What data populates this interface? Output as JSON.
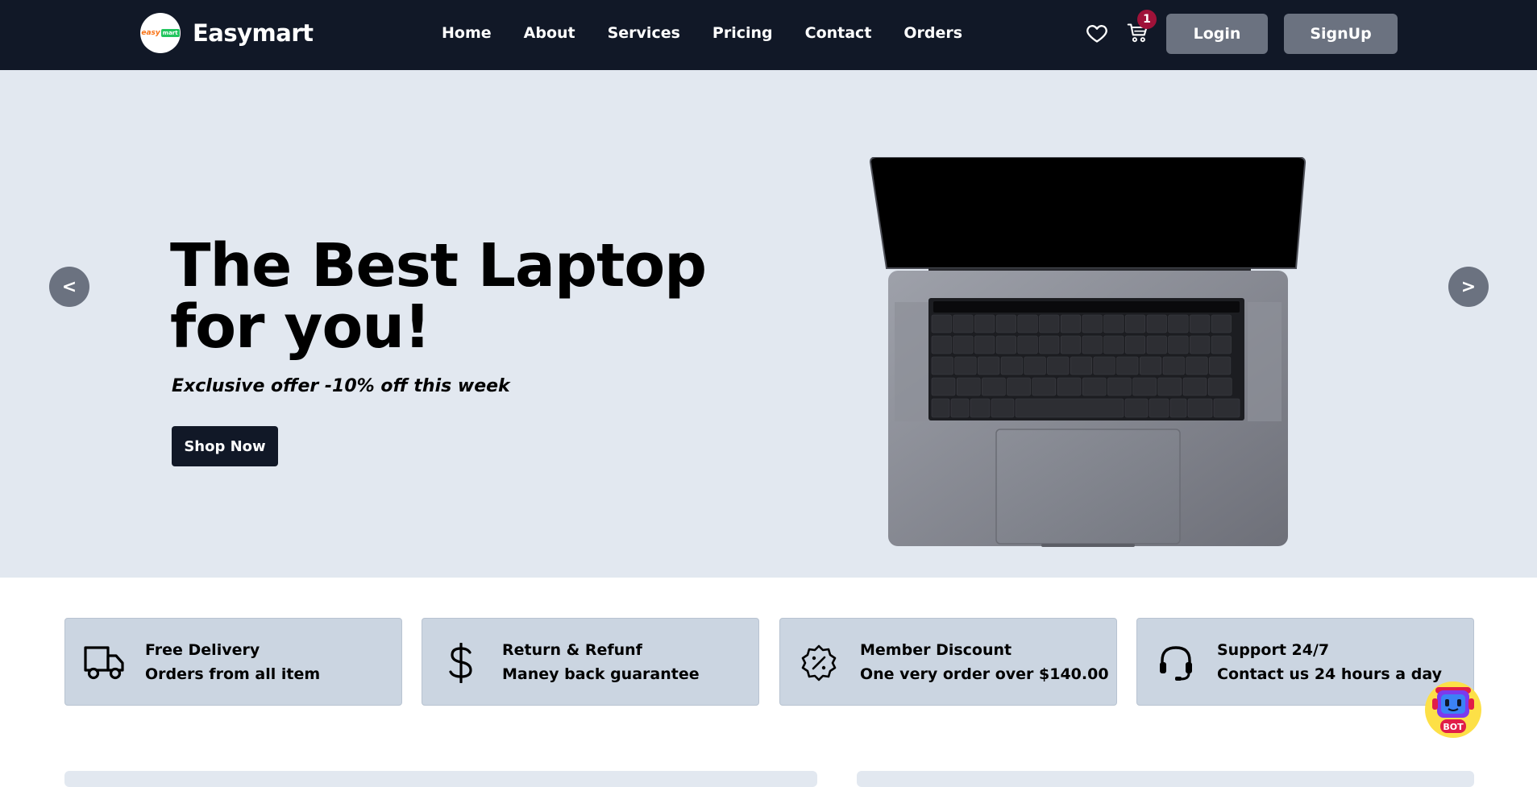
{
  "nav": {
    "logo_text_1": "easy",
    "logo_text_2": "mart",
    "brand": "Easymart",
    "links": [
      "Home",
      "About",
      "Services",
      "Pricing",
      "Contact",
      "Orders"
    ],
    "cart_count": "1",
    "login_label": "Login",
    "signup_label": "SignUp"
  },
  "hero": {
    "title": "The Best Laptop for you!",
    "subtitle": "Exclusive offer -10% off this week",
    "cta_label": "Shop Now",
    "prev_label": "<",
    "next_label": ">"
  },
  "features": [
    {
      "icon": "truck-icon",
      "title": "Free Delivery",
      "desc": "Orders from all item"
    },
    {
      "icon": "dollar-icon",
      "title": "Return & Refunf",
      "desc": "Maney back guarantee"
    },
    {
      "icon": "discount-badge-icon",
      "title": "Member Discount",
      "desc": "One very order over $140.00"
    },
    {
      "icon": "headset-icon",
      "title": "Support 24/7",
      "desc": "Contact us 24 hours a day"
    }
  ],
  "bot_label": "BOT",
  "colors": {
    "navbar": "#111827",
    "hero_bg": "#e2e8f0",
    "button_gray": "#6b7280",
    "cart_badge": "#9f1239",
    "feature_bg": "#cbd5e1"
  }
}
